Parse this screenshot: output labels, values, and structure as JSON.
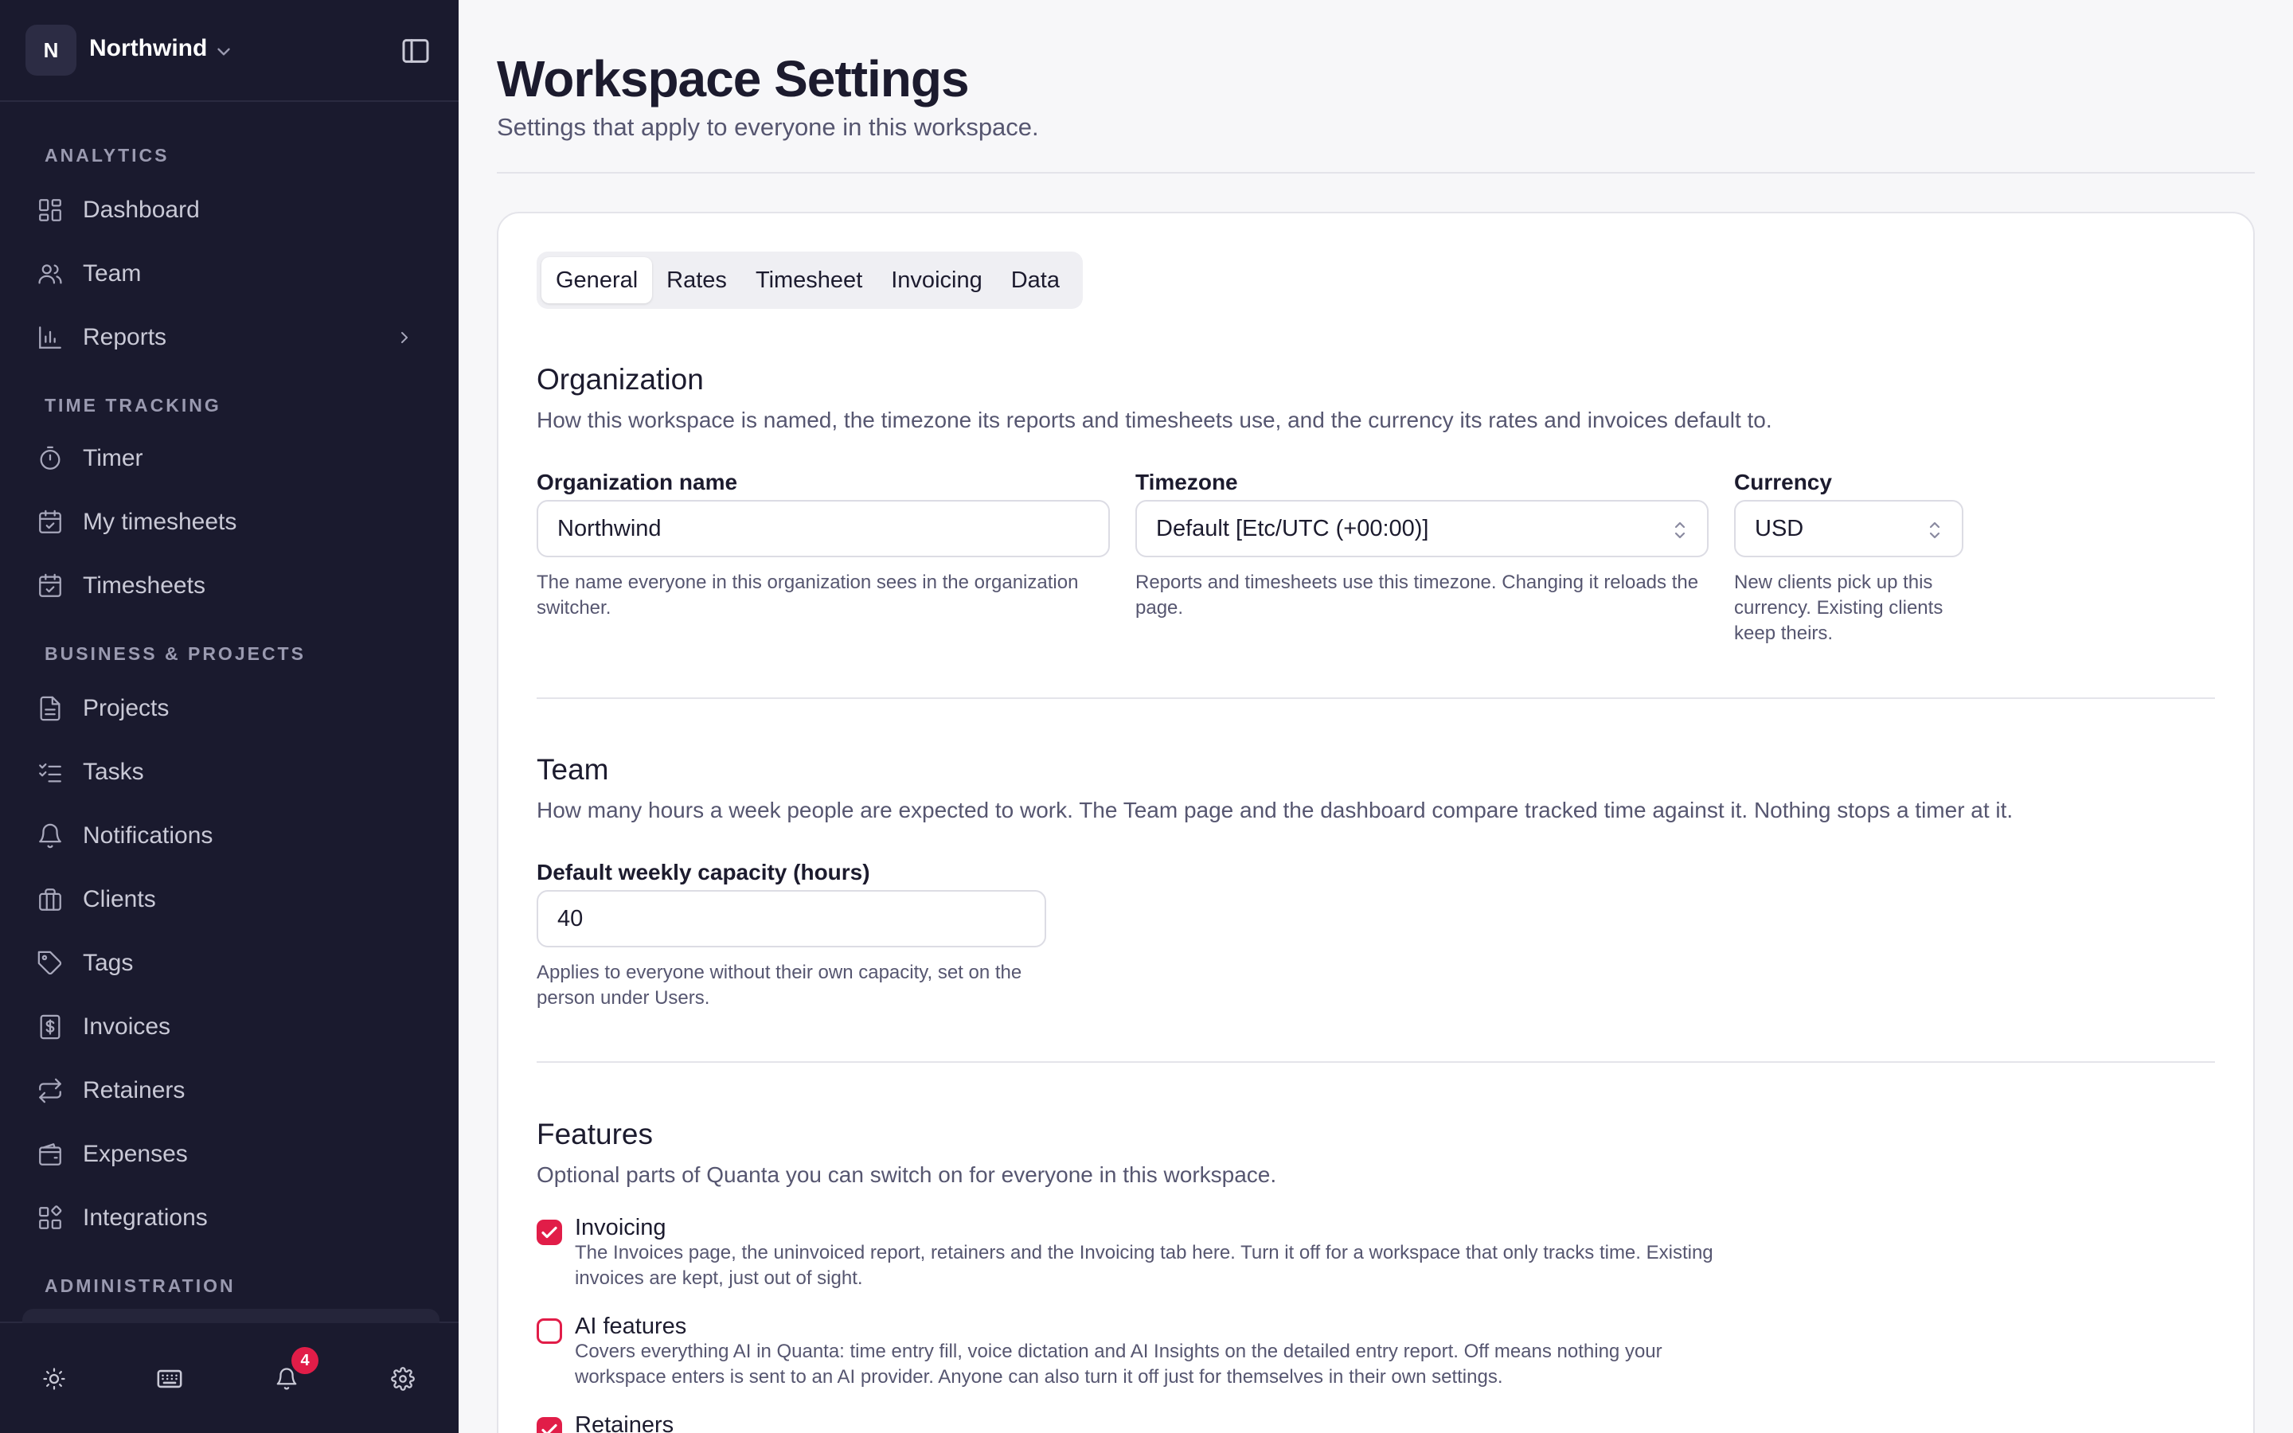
{
  "workspace": {
    "initial": "N",
    "name": "Northwind"
  },
  "sidebar": {
    "sections": [
      {
        "title": "ANALYTICS"
      },
      {
        "title": "TIME TRACKING"
      },
      {
        "title": "BUSINESS & PROJECTS"
      },
      {
        "title": "ADMINISTRATION"
      }
    ],
    "items": [
      {
        "label": "Dashboard",
        "icon": "dashboard-icon"
      },
      {
        "label": "Team",
        "icon": "users-icon"
      },
      {
        "label": "Reports",
        "icon": "bar-chart-icon"
      },
      {
        "label": "Timer",
        "icon": "stopwatch-icon"
      },
      {
        "label": "My timesheets",
        "icon": "calendar-check-icon"
      },
      {
        "label": "Timesheets",
        "icon": "calendar-check-icon"
      },
      {
        "label": "Projects",
        "icon": "document-icon"
      },
      {
        "label": "Tasks",
        "icon": "checklist-icon"
      },
      {
        "label": "Notifications",
        "icon": "bell-icon"
      },
      {
        "label": "Clients",
        "icon": "briefcase-icon"
      },
      {
        "label": "Tags",
        "icon": "tag-icon"
      },
      {
        "label": "Invoices",
        "icon": "invoice-icon"
      },
      {
        "label": "Retainers",
        "icon": "repeat-icon"
      },
      {
        "label": "Expenses",
        "icon": "wallet-icon"
      },
      {
        "label": "Integrations",
        "icon": "integrations-icon"
      }
    ],
    "footer": {
      "notification_count": "4"
    }
  },
  "page": {
    "title": "Workspace Settings",
    "subtitle": "Settings that apply to everyone in this workspace."
  },
  "tabs": [
    {
      "label": "General",
      "active": true
    },
    {
      "label": "Rates",
      "active": false
    },
    {
      "label": "Timesheet",
      "active": false
    },
    {
      "label": "Invoicing",
      "active": false
    },
    {
      "label": "Data",
      "active": false
    }
  ],
  "organization": {
    "title": "Organization",
    "description": "How this workspace is named, the timezone its reports and timesheets use, and the currency its rates and invoices default to.",
    "name_field": {
      "label": "Organization name",
      "value": "Northwind",
      "help": "The name everyone in this organization sees in the organization switcher."
    },
    "timezone_field": {
      "label": "Timezone",
      "value": "Default [Etc/UTC (+00:00)]",
      "help": "Reports and timesheets use this timezone. Changing it reloads the page."
    },
    "currency_field": {
      "label": "Currency",
      "value": "USD",
      "help": "New clients pick up this currency. Existing clients keep theirs."
    }
  },
  "team": {
    "title": "Team",
    "description": "How many hours a week people are expected to work. The Team page and the dashboard compare tracked time against it. Nothing stops a timer at it.",
    "capacity_field": {
      "label": "Default weekly capacity (hours)",
      "value": "40",
      "help": "Applies to everyone without their own capacity, set on the person under Users."
    }
  },
  "features": {
    "title": "Features",
    "description": "Optional parts of Quanta you can switch on for everyone in this workspace.",
    "items": [
      {
        "title": "Invoicing",
        "checked": true,
        "description": "The Invoices page, the uninvoiced report, retainers and the Invoicing tab here. Turn it off for a workspace that only tracks time. Existing invoices are kept, just out of sight."
      },
      {
        "title": "AI features",
        "checked": false,
        "description": "Covers everything AI in Quanta: time entry fill, voice dictation and AI Insights on the detailed entry report. Off means nothing your workspace enters is sent to an AI provider. Anyone can also turn it off just for themselves in their own settings."
      },
      {
        "title": "Retainers",
        "checked": true,
        "description": ""
      }
    ]
  },
  "colors": {
    "sidebar_bg": "#1a1a2e",
    "accent": "#e11d48",
    "page_bg": "#f7f7f9"
  }
}
